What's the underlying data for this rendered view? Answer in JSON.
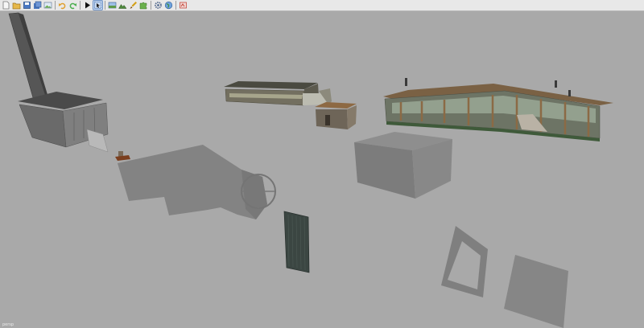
{
  "toolbar": {
    "buttons": [
      {
        "name": "new-file-icon",
        "color": "#f2f2f2"
      },
      {
        "name": "open-folder-icon",
        "color": "#e0b54a"
      },
      {
        "name": "save-icon",
        "color": "#4a78c2"
      },
      {
        "name": "save-all-icon",
        "color": "#4a78c2"
      },
      {
        "name": "image-icon",
        "color": "#6ab04c"
      },
      {
        "name": "undo-icon",
        "color": "#e0a030"
      },
      {
        "name": "redo-icon",
        "color": "#4caf50"
      },
      {
        "name": "play-icon",
        "color": "#000000"
      },
      {
        "name": "select-icon",
        "color": "#4a78c2",
        "active": true
      },
      {
        "name": "scene-icon",
        "color": "#5a8ac9"
      },
      {
        "name": "terrain-icon",
        "color": "#4e8a3c"
      },
      {
        "name": "brush-icon",
        "color": "#d4a017"
      },
      {
        "name": "puzzle-icon",
        "color": "#6ab04c"
      },
      {
        "name": "settings-icon",
        "color": "#556b8f"
      },
      {
        "name": "globe-icon",
        "color": "#3a77c2"
      },
      {
        "name": "debug-icon",
        "color": "#c0392b"
      }
    ]
  },
  "viewport": {
    "camera_label": "persp",
    "background_color": "#a9a9a9",
    "placeholder_color": "#838383"
  }
}
